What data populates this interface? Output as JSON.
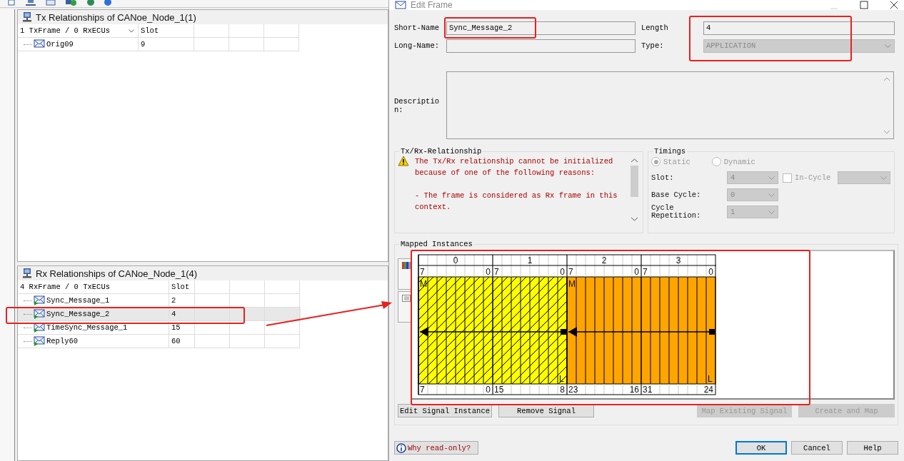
{
  "tx_panel": {
    "title": "Tx Relationships of CANoe_Node_1(1)",
    "columns": [
      "1 TxFrame / 0 RxECUs",
      "Slot"
    ],
    "rows": [
      {
        "name": "Orig09",
        "slot": "9",
        "selected": false
      }
    ]
  },
  "rx_panel": {
    "title": "Rx Relationships of CANoe_Node_1(4)",
    "columns": [
      "4 RxFrame / 0 TxECUs",
      "Slot"
    ],
    "rows": [
      {
        "name": "Sync_Message_1",
        "slot": "2",
        "selected": false
      },
      {
        "name": "Sync_Message_2",
        "slot": "4",
        "selected": true
      },
      {
        "name": "TimeSync_Message_1",
        "slot": "15",
        "selected": false
      },
      {
        "name": "Reply60",
        "slot": "60",
        "selected": false
      }
    ]
  },
  "dialog": {
    "title": "Edit Frame",
    "short_name_label": "Short-Name",
    "short_name": "Sync_Message_2",
    "length_label": "Length",
    "length": "4",
    "long_name_label": "Long-Name:",
    "type_label": "Type:",
    "type": "APPLICATION",
    "description_label": "Description:"
  },
  "txrx": {
    "title": "Tx/Rx-Relationship",
    "paragraphs": [
      [
        "The Tx/Rx relationship cannot be initialized",
        "because of one of the following reasons:"
      ],
      [
        "- The frame is considered as Rx frame in this",
        "context."
      ]
    ]
  },
  "timings": {
    "title": "Timings",
    "modes": [
      {
        "label": "Static",
        "selected": true
      },
      {
        "label": "Dynamic",
        "selected": false
      }
    ],
    "slot_label": "Slot:",
    "slot": "4",
    "in_cycle": {
      "label": "In-Cycle",
      "checked": false
    },
    "base_cycle_label": "Base Cycle:",
    "base_cycle": "0",
    "cycle_repetition_label": "Cycle Repetition:",
    "cycle_repetition": "1"
  },
  "mapped_instances": {
    "title": "Mapped Instances",
    "signals": [
      {
        "color": "#ffff00",
        "hatched": true,
        "msb_mark": "M",
        "lsb_mark": "L",
        "bytes": [
          {
            "header": "0",
            "top_msb": "7",
            "top_lsb": "0",
            "bottom_msb": "7",
            "bottom_lsb": "0"
          },
          {
            "header": "1",
            "top_msb": "7",
            "top_lsb": "0",
            "bottom_msb": "15",
            "bottom_lsb": "8"
          }
        ]
      },
      {
        "color": "#ffa500",
        "hatched": false,
        "msb_mark": "M",
        "lsb_mark": "L",
        "bytes": [
          {
            "header": "2",
            "top_msb": "7",
            "top_lsb": "0",
            "bottom_msb": "23",
            "bottom_lsb": "16"
          },
          {
            "header": "3",
            "top_msb": "7",
            "top_lsb": "0",
            "bottom_msb": "31",
            "bottom_lsb": "24"
          }
        ]
      }
    ]
  },
  "signal_buttons": [
    {
      "label": "Edit Signal Instance",
      "disabled": false
    },
    {
      "label": "Remove Signal",
      "disabled": false
    },
    {
      "label": "Map Existing Signal",
      "disabled": true
    },
    {
      "label": "Create and Map",
      "disabled": true
    }
  ],
  "footer": {
    "why_button": "Why read-only?",
    "buttons": [
      {
        "label": "OK",
        "focused": true
      },
      {
        "label": "Cancel",
        "focused": false
      },
      {
        "label": "Help",
        "focused": false
      }
    ]
  }
}
